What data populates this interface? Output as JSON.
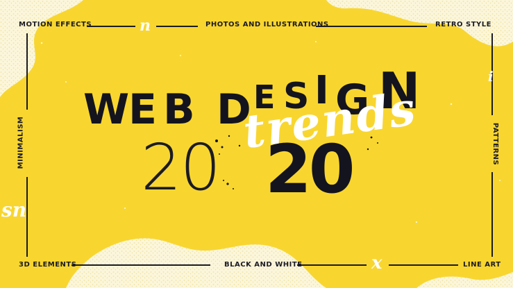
{
  "colors": {
    "background": "#f8d62f",
    "ink": "#14141e",
    "paint": "#fdfbee"
  },
  "labels": {
    "top_left": "MOTION EFFECTS",
    "top_center": "PHOTOS AND ILLUSTRATIONS",
    "top_right": "RETRO STYLE",
    "left_side": "MINIMALISM",
    "right_side": "PATTERNS",
    "bottom_left": "3D ELEMENTS",
    "bottom_center": "BLACK AND WHITE",
    "bottom_right": "LINE ART"
  },
  "headline": {
    "web_design": [
      "W",
      "E",
      "B",
      "D",
      "E",
      "S",
      "I",
      "G",
      "N"
    ],
    "script_word": "trends",
    "year_light": "20",
    "year_bold": "20"
  },
  "decorations": {
    "n_glyph": "n",
    "x_glyph": "x",
    "i_glyph": "i",
    "left_glyph": "sn"
  }
}
